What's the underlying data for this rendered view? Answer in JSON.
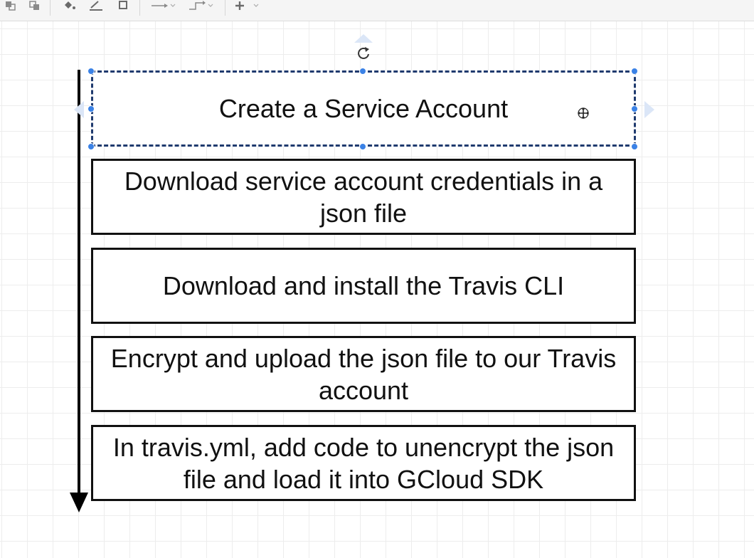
{
  "toolbar": {
    "icons": [
      "to-front-icon",
      "to-back-icon",
      "fill-color-icon",
      "line-color-icon",
      "shadow-icon",
      "connection-icon",
      "waypoints-icon",
      "insert-icon"
    ]
  },
  "diagram": {
    "steps": [
      "Create a Service Account",
      "Download service account credentials in a json file",
      "Download and install the Travis CLI",
      "Encrypt and upload the json file to our Travis account",
      "In travis.yml, add code to unencrypt the json file and load it into GCloud SDK"
    ],
    "selected_index": 0
  },
  "colors": {
    "selection_handle": "#3b82e6",
    "box_border": "#111111",
    "grid": "#ededed"
  }
}
